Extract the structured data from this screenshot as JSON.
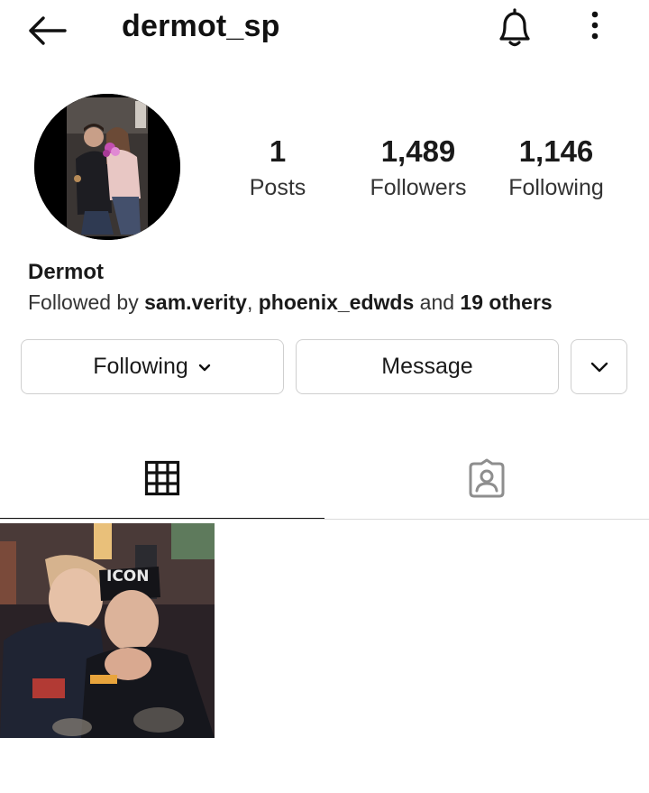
{
  "header": {
    "username": "dermot_sp",
    "back_icon": "arrow-left-icon",
    "bell_icon": "bell-icon",
    "more_icon": "vertical-dots-icon"
  },
  "profile": {
    "avatar_icon": "profile-photo",
    "stats": [
      {
        "value": "1",
        "label": "Posts"
      },
      {
        "value": "1,489",
        "label": "Followers"
      },
      {
        "value": "1,146",
        "label": "Following"
      }
    ],
    "display_name": "Dermot",
    "followed_by": {
      "prefix": "Followed by ",
      "user1": "sam.verity",
      "sep": ", ",
      "user2": "phoenix_edwds",
      "and": " and ",
      "others": "19 others"
    }
  },
  "actions": {
    "following_label": "Following",
    "message_label": "Message"
  },
  "tabs": {
    "grid_icon": "grid-icon",
    "tagged_icon": "tagged-person-icon",
    "active": "grid"
  },
  "posts": [
    {
      "overlay_text": "ICON"
    }
  ],
  "colors": {
    "text": "#262626",
    "border": "#cfcfcf",
    "divider": "#dbdbdb"
  }
}
